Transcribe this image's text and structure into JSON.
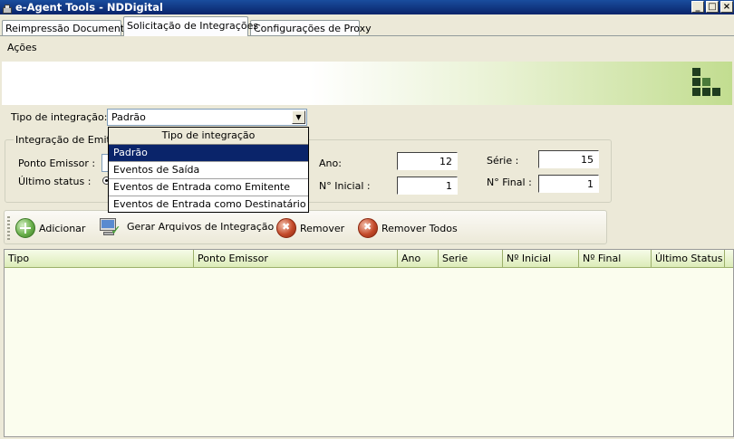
{
  "window": {
    "title": "e-Agent Tools - NDDigital",
    "minimize_glyph": "_",
    "maximize_glyph": "□",
    "close_glyph": "×"
  },
  "tabs": [
    {
      "label": "Reimpressão Documentos",
      "active": false
    },
    {
      "label": "Solicitação de Integrações",
      "active": true
    },
    {
      "label": "Configurações de Proxy",
      "active": false
    }
  ],
  "menu": {
    "acoes": "Ações"
  },
  "form": {
    "tipo_label": "Tipo de integração:",
    "tipo_value": "Padrão",
    "group_title": "Integração de Emitente",
    "ponto_emissor_label": "Ponto Emissor :",
    "ultimo_status_label": "Último status :",
    "ano_label": "Ano:",
    "ano_value": "12",
    "n_inicial_label": "N° Inicial :",
    "n_inicial_value": "1",
    "serie_label": "Série :",
    "serie_value": "15",
    "n_final_label": "N° Final :",
    "n_final_value": "1"
  },
  "dropdown": {
    "header": "Tipo de integração",
    "options": [
      "Padrão",
      "Eventos de Saída",
      "Eventos de Entrada como Emitente",
      "Eventos de Entrada como Destinatário"
    ],
    "selected_index": 0
  },
  "toolbar": {
    "adicionar": "Adicionar",
    "gerar": "Gerar Arquivos de Integração",
    "remover": "Remover",
    "remover_todos": "Remover Todos"
  },
  "grid": {
    "columns": [
      "Tipo",
      "Ponto Emissor",
      "Ano",
      "Serie",
      "Nº Inicial",
      "Nº Final",
      "Último Status"
    ],
    "rows": []
  },
  "colors": {
    "title_bar": "#0a246a",
    "grid_header": "#dcecb8",
    "grid_body": "#fbfdee",
    "selection": "#0a246a"
  }
}
